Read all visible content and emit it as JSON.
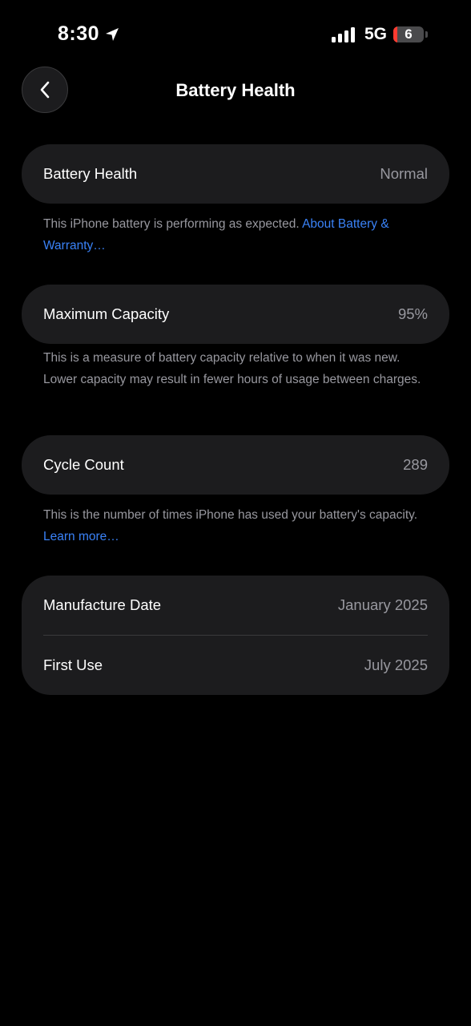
{
  "status_bar": {
    "time": "8:30",
    "network": "5G",
    "battery_level": "6",
    "battery_fraction": 0.06,
    "battery_fill_color": "#ff3b30",
    "icons": [
      "location-arrow-icon",
      "signal-bars-icon",
      "battery-icon"
    ]
  },
  "nav": {
    "title": "Battery Health",
    "back_icon": "chevron-left-icon"
  },
  "sections": {
    "health": {
      "label": "Battery Health",
      "value": "Normal",
      "footnote_text": "This iPhone battery is performing as expected. ",
      "footnote_link": "About Battery & Warranty…"
    },
    "capacity": {
      "label": "Maximum Capacity",
      "value": "95%",
      "footnote_text": "This is a measure of battery capacity relative to when it was new. Lower capacity may result in fewer hours of usage between charges."
    },
    "cycles": {
      "label": "Cycle Count",
      "value": "289",
      "footnote_text": "This is the number of times iPhone has used your battery's capacity. ",
      "footnote_link": "Learn more…"
    },
    "dates": {
      "manufacture_label": "Manufacture Date",
      "manufacture_value": "January 2025",
      "first_use_label": "First Use",
      "first_use_value": "July 2025"
    }
  },
  "colors": {
    "background": "#000000",
    "card": "#1c1c1e",
    "secondary_text": "#98989f",
    "link": "#3a82f7"
  }
}
